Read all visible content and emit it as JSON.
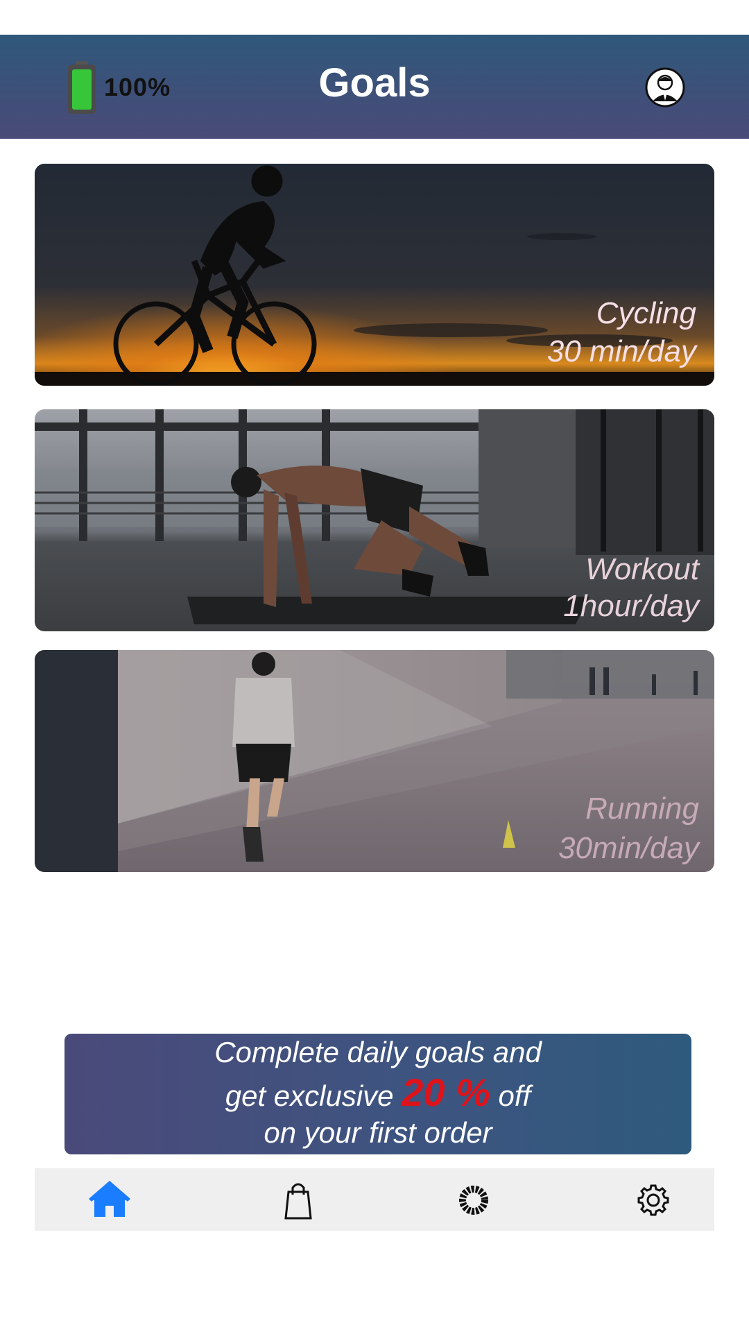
{
  "header": {
    "battery_text": "100%",
    "title": "Goals"
  },
  "goals": [
    {
      "name": "Cycling",
      "target": "30 min/day"
    },
    {
      "name": "Workout",
      "target": "1hour/day"
    },
    {
      "name": "Running",
      "target": "30min/day"
    }
  ],
  "promo": {
    "line1": "Complete daily goals and",
    "line2_before": "get exclusive ",
    "percent": "20 %",
    "line2_after": " off",
    "line3": "on your first order"
  },
  "nav": {
    "icons": [
      "home-icon",
      "shopping-bag-icon",
      "circle-icon",
      "gear-icon"
    ],
    "active_color": "#1a7cff"
  },
  "colors": {
    "header_top": "#2f587a",
    "header_bottom": "#4a4a78",
    "promo_highlight": "#e0121a",
    "battery_fill": "#37c53a"
  }
}
